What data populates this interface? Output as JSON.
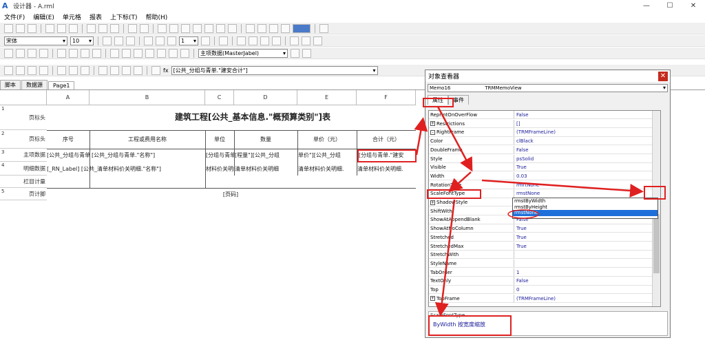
{
  "window": {
    "title": "设计器 - A.rml",
    "controls": [
      "—",
      "☐",
      "✕"
    ]
  },
  "menu": [
    "文件(F)",
    "编辑(E)",
    "单元格",
    "报表",
    "上下标(T)",
    "帮助(H)"
  ],
  "toolbar2": {
    "font_name": "宋体",
    "font_size": "10",
    "line_width": "1",
    "dataset_select": "主项数据(MasterJabel)"
  },
  "toolbar4": {
    "expression_label": "fx",
    "expression_value": "[公共_分组与青单.\"建安合计\"]"
  },
  "tabs": [
    "脚本",
    "数据源",
    "Page1"
  ],
  "grid": {
    "columns": [
      "A",
      "B",
      "C",
      "D",
      "E",
      "F"
    ],
    "rows": [
      {
        "num": "1",
        "label": "页标头"
      },
      {
        "num": "2",
        "label": "页标头"
      },
      {
        "num": "3",
        "label": "主项数据"
      },
      {
        "num": "4",
        "label": "明细数据"
      },
      {
        "num": "",
        "label": "栏目计量"
      },
      {
        "num": "5",
        "label": "页计脚"
      }
    ],
    "title_text": "建筑工程[公共_基本信息.\"概预算类别\"]表",
    "headers": [
      "序号",
      "工程或费用名称",
      "单位",
      "数量",
      "单价（元）",
      "合计（元）"
    ],
    "row3": [
      "[公共_分组与青单.\"序",
      "[公共_分组与青单.\"名称\"]",
      "[分组与青单",
      "[程量\"][公共_分组",
      "单价\"][公共_分组",
      "[分组与青单.\"建安"
    ],
    "row4": [
      "[_RN_Label] [公共_清单材料价关明细.\"名称\"]",
      "",
      "材料价关明细",
      "清单材料价关明细",
      "清单材料价关明细.",
      "清单材料价关明细."
    ],
    "footer_text": "[页码]"
  },
  "inspector": {
    "title": "对象查看器",
    "object_name": "Memo16",
    "object_type": "TRMMemoView",
    "tabs": [
      "属性",
      "事件"
    ],
    "properties": [
      {
        "name": "ReprintOnOverFlow",
        "value": "False",
        "expand": ""
      },
      {
        "name": "Restrictions",
        "value": "[]",
        "expand": "+"
      },
      {
        "name": "RightFrame",
        "value": "(TRMFrameLine)",
        "expand": "-"
      },
      {
        "name": "  Color",
        "value": "clBlack",
        "expand": ""
      },
      {
        "name": "  DoubleFrame",
        "value": "False",
        "expand": ""
      },
      {
        "name": "  Style",
        "value": "psSolid",
        "expand": ""
      },
      {
        "name": "  Visible",
        "value": "True",
        "expand": ""
      },
      {
        "name": "  Width",
        "value": "0.03",
        "expand": ""
      },
      {
        "name": "RotationType",
        "value": "rmrtNone",
        "expand": ""
      },
      {
        "name": "ScaleFontType",
        "value": "rmstNone",
        "expand": ""
      },
      {
        "name": "ShadowStyle",
        "value": "",
        "expand": "+"
      },
      {
        "name": "ShiftWith",
        "value": "",
        "expand": ""
      },
      {
        "name": "ShowAtAppendBlank",
        "value": "False",
        "expand": ""
      },
      {
        "name": "ShowAtNoColumn",
        "value": "True",
        "expand": ""
      },
      {
        "name": "Stretched",
        "value": "True",
        "expand": ""
      },
      {
        "name": "StretchedMax",
        "value": "True",
        "expand": ""
      },
      {
        "name": "StretchWith",
        "value": "",
        "expand": ""
      },
      {
        "name": "StyleName",
        "value": "",
        "expand": ""
      },
      {
        "name": "TabOrder",
        "value": "1",
        "expand": ""
      },
      {
        "name": "TextOnly",
        "value": "False",
        "expand": ""
      },
      {
        "name": "Top",
        "value": "0",
        "expand": ""
      },
      {
        "name": "TopFrame",
        "value": "(TRMFrameLine)",
        "expand": "+"
      }
    ],
    "dropdown_options": [
      "rmstByWidth",
      "rmstByHeight",
      "rmstNone"
    ],
    "dropdown_selected": "rmstNone",
    "description_name": "ScaleFontType",
    "description_text": "ByWidth 按宽度缩放"
  },
  "colors": {
    "highlight": "#e02020",
    "selection": "#1e6fd9",
    "value_text": "#1a1a9a"
  }
}
